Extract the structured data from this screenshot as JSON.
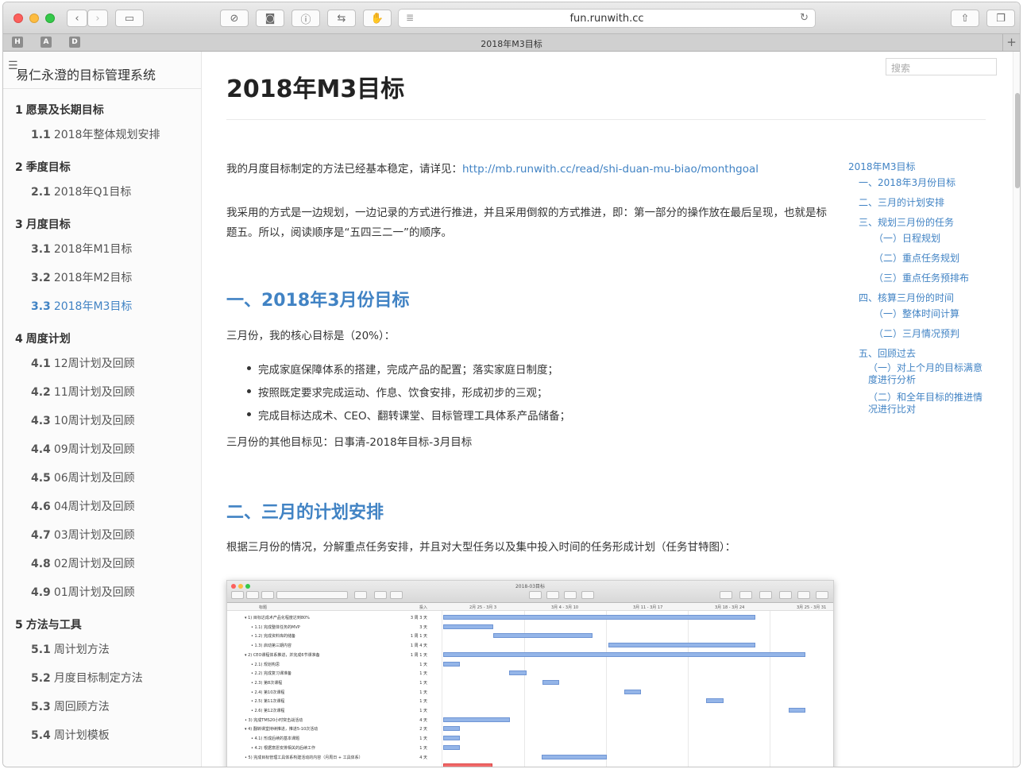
{
  "browser": {
    "url": "fun.runwith.cc",
    "tab_title": "2018年M3目标",
    "favorites": [
      "H",
      "A",
      "D"
    ]
  },
  "sidebar": {
    "title": "易仁永澄的目标管理系统",
    "items": [
      {
        "num": "1",
        "label": "愿景及长期目标",
        "level": 1
      },
      {
        "num": "1.1",
        "label": "2018年整体规划安排",
        "level": 2
      },
      {
        "num": "2",
        "label": "季度目标",
        "level": 1
      },
      {
        "num": "2.1",
        "label": "2018年Q1目标",
        "level": 2
      },
      {
        "num": "3",
        "label": "月度目标",
        "level": 1
      },
      {
        "num": "3.1",
        "label": "2018年M1目标",
        "level": 2
      },
      {
        "num": "3.2",
        "label": "2018年M2目标",
        "level": 2
      },
      {
        "num": "3.3",
        "label": "2018年M3目标",
        "level": 2,
        "active": true
      },
      {
        "num": "4",
        "label": "周度计划",
        "level": 1
      },
      {
        "num": "4.1",
        "label": "12周计划及回顾",
        "level": 2
      },
      {
        "num": "4.2",
        "label": "11周计划及回顾",
        "level": 2
      },
      {
        "num": "4.3",
        "label": "10周计划及回顾",
        "level": 2
      },
      {
        "num": "4.4",
        "label": "09周计划及回顾",
        "level": 2
      },
      {
        "num": "4.5",
        "label": "06周计划及回顾",
        "level": 2
      },
      {
        "num": "4.6",
        "label": "04周计划及回顾",
        "level": 2
      },
      {
        "num": "4.7",
        "label": "03周计划及回顾",
        "level": 2
      },
      {
        "num": "4.8",
        "label": "02周计划及回顾",
        "level": 2
      },
      {
        "num": "4.9",
        "label": "01周计划及回顾",
        "level": 2
      },
      {
        "num": "5",
        "label": "方法与工具",
        "level": 1
      },
      {
        "num": "5.1",
        "label": "周计划方法",
        "level": 2
      },
      {
        "num": "5.2",
        "label": "月度目标制定方法",
        "level": 2
      },
      {
        "num": "5.3",
        "label": "周回顾方法",
        "level": 2
      },
      {
        "num": "5.4",
        "label": "周计划模板",
        "level": 2
      }
    ]
  },
  "search": {
    "placeholder": "搜索"
  },
  "article": {
    "title": "2018年M3目标",
    "intro_text": "我的月度目标制定的方法已经基本稳定，请详见：",
    "intro_link": "http://mb.runwith.cc/read/shi-duan-mu-biao/monthgoal",
    "para2": "我采用的方式是一边规划，一边记录的方式进行推进，并且采用倒叙的方式推进，即：第一部分的操作放在最后呈现，也就是标题五。所以，阅读顺序是“五四三二一”的顺序。",
    "h2_1": "一、2018年3月份目标",
    "core": "三月份，我的核心目标是（20%）：",
    "bullets": [
      "完成家庭保障体系的搭建，完成产品的配置；落实家庭日制度；",
      "按照既定要求完成运动、作息、饮食安排，形成初步的三观；",
      "完成目标达成术、CEO、翻转课堂、目标管理工具体系产品储备；"
    ],
    "other": "三月份的其他目标见：日事清-2018年目标-3月目标",
    "h2_2": "二、三月的计划安排",
    "plan": "根据三月份的情况，分解重点任务安排，并且对大型任务以及集中投入时间的任务形成计划（任务甘特图）："
  },
  "toc": [
    "2018年M3目标",
    "一、2018年3月份目标",
    "二、三月的计划安排",
    "三、规划三月份的任务",
    "（一）日程规划",
    "（二）重点任务规划",
    "（三）重点任务预排布",
    "四、核算三月份的时间",
    "（一）整体时间计算",
    "（二）三月情况预判",
    "五、回顾过去",
    "（一）对上个月的目标满意度进行分析",
    "（二）和全年目标的推进情况进行比对"
  ],
  "gantt": {
    "window_title": "2018-03目标",
    "col_title": "标题",
    "col_effort": "投入",
    "weeks": [
      "2月 25 - 3月 3",
      "3月 4 - 3月 10",
      "3月 11 - 3月 17",
      "3月 18 - 3月 24",
      "3月 25 - 3月 31"
    ],
    "rows": [
      {
        "name": "▾ 1) 目标达成术产品化程度达到80%",
        "effort": "3 周 3 天"
      },
      {
        "name": "• 1.1) 完成整体任务的MVP",
        "effort": "3 天"
      },
      {
        "name": "• 1.2) 完成资料库的储备",
        "effort": "1 周 1 天"
      },
      {
        "name": "• 1.3) 启动第三期内容",
        "effort": "1 周 4 天"
      },
      {
        "name": "▾ 2) CEO课程体系推进，并完成6节课准备",
        "effort": "1 周 1 天"
      },
      {
        "name": "• 2.1) 规划构思",
        "effort": "1 天"
      },
      {
        "name": "• 2.2) 完成复习课准备",
        "effort": "1 天"
      },
      {
        "name": "• 2.3) 第8次课程",
        "effort": "1 天"
      },
      {
        "name": "• 2.4) 第10次课程",
        "effort": "1 天"
      },
      {
        "name": "• 2.5) 第11次课程",
        "effort": "1 天"
      },
      {
        "name": "• 2.6) 第12次课程",
        "effort": "1 天"
      },
      {
        "name": "• 3) 完成TMS20小时突击战活动",
        "effort": "4 天"
      },
      {
        "name": "▾ 4) 翻转课堂持续推进，推进5-10次活动",
        "effort": "2 天"
      },
      {
        "name": "• 4.1) 形成后续的基本课题",
        "effort": "1 天"
      },
      {
        "name": "• 4.2) 根据意愿安排相关的后续工作",
        "effort": "1 天"
      },
      {
        "name": "• 5) 完成目标管理工具体系构建活动的内容（月周日 + 工具体系）",
        "effort": "4 天"
      }
    ]
  }
}
